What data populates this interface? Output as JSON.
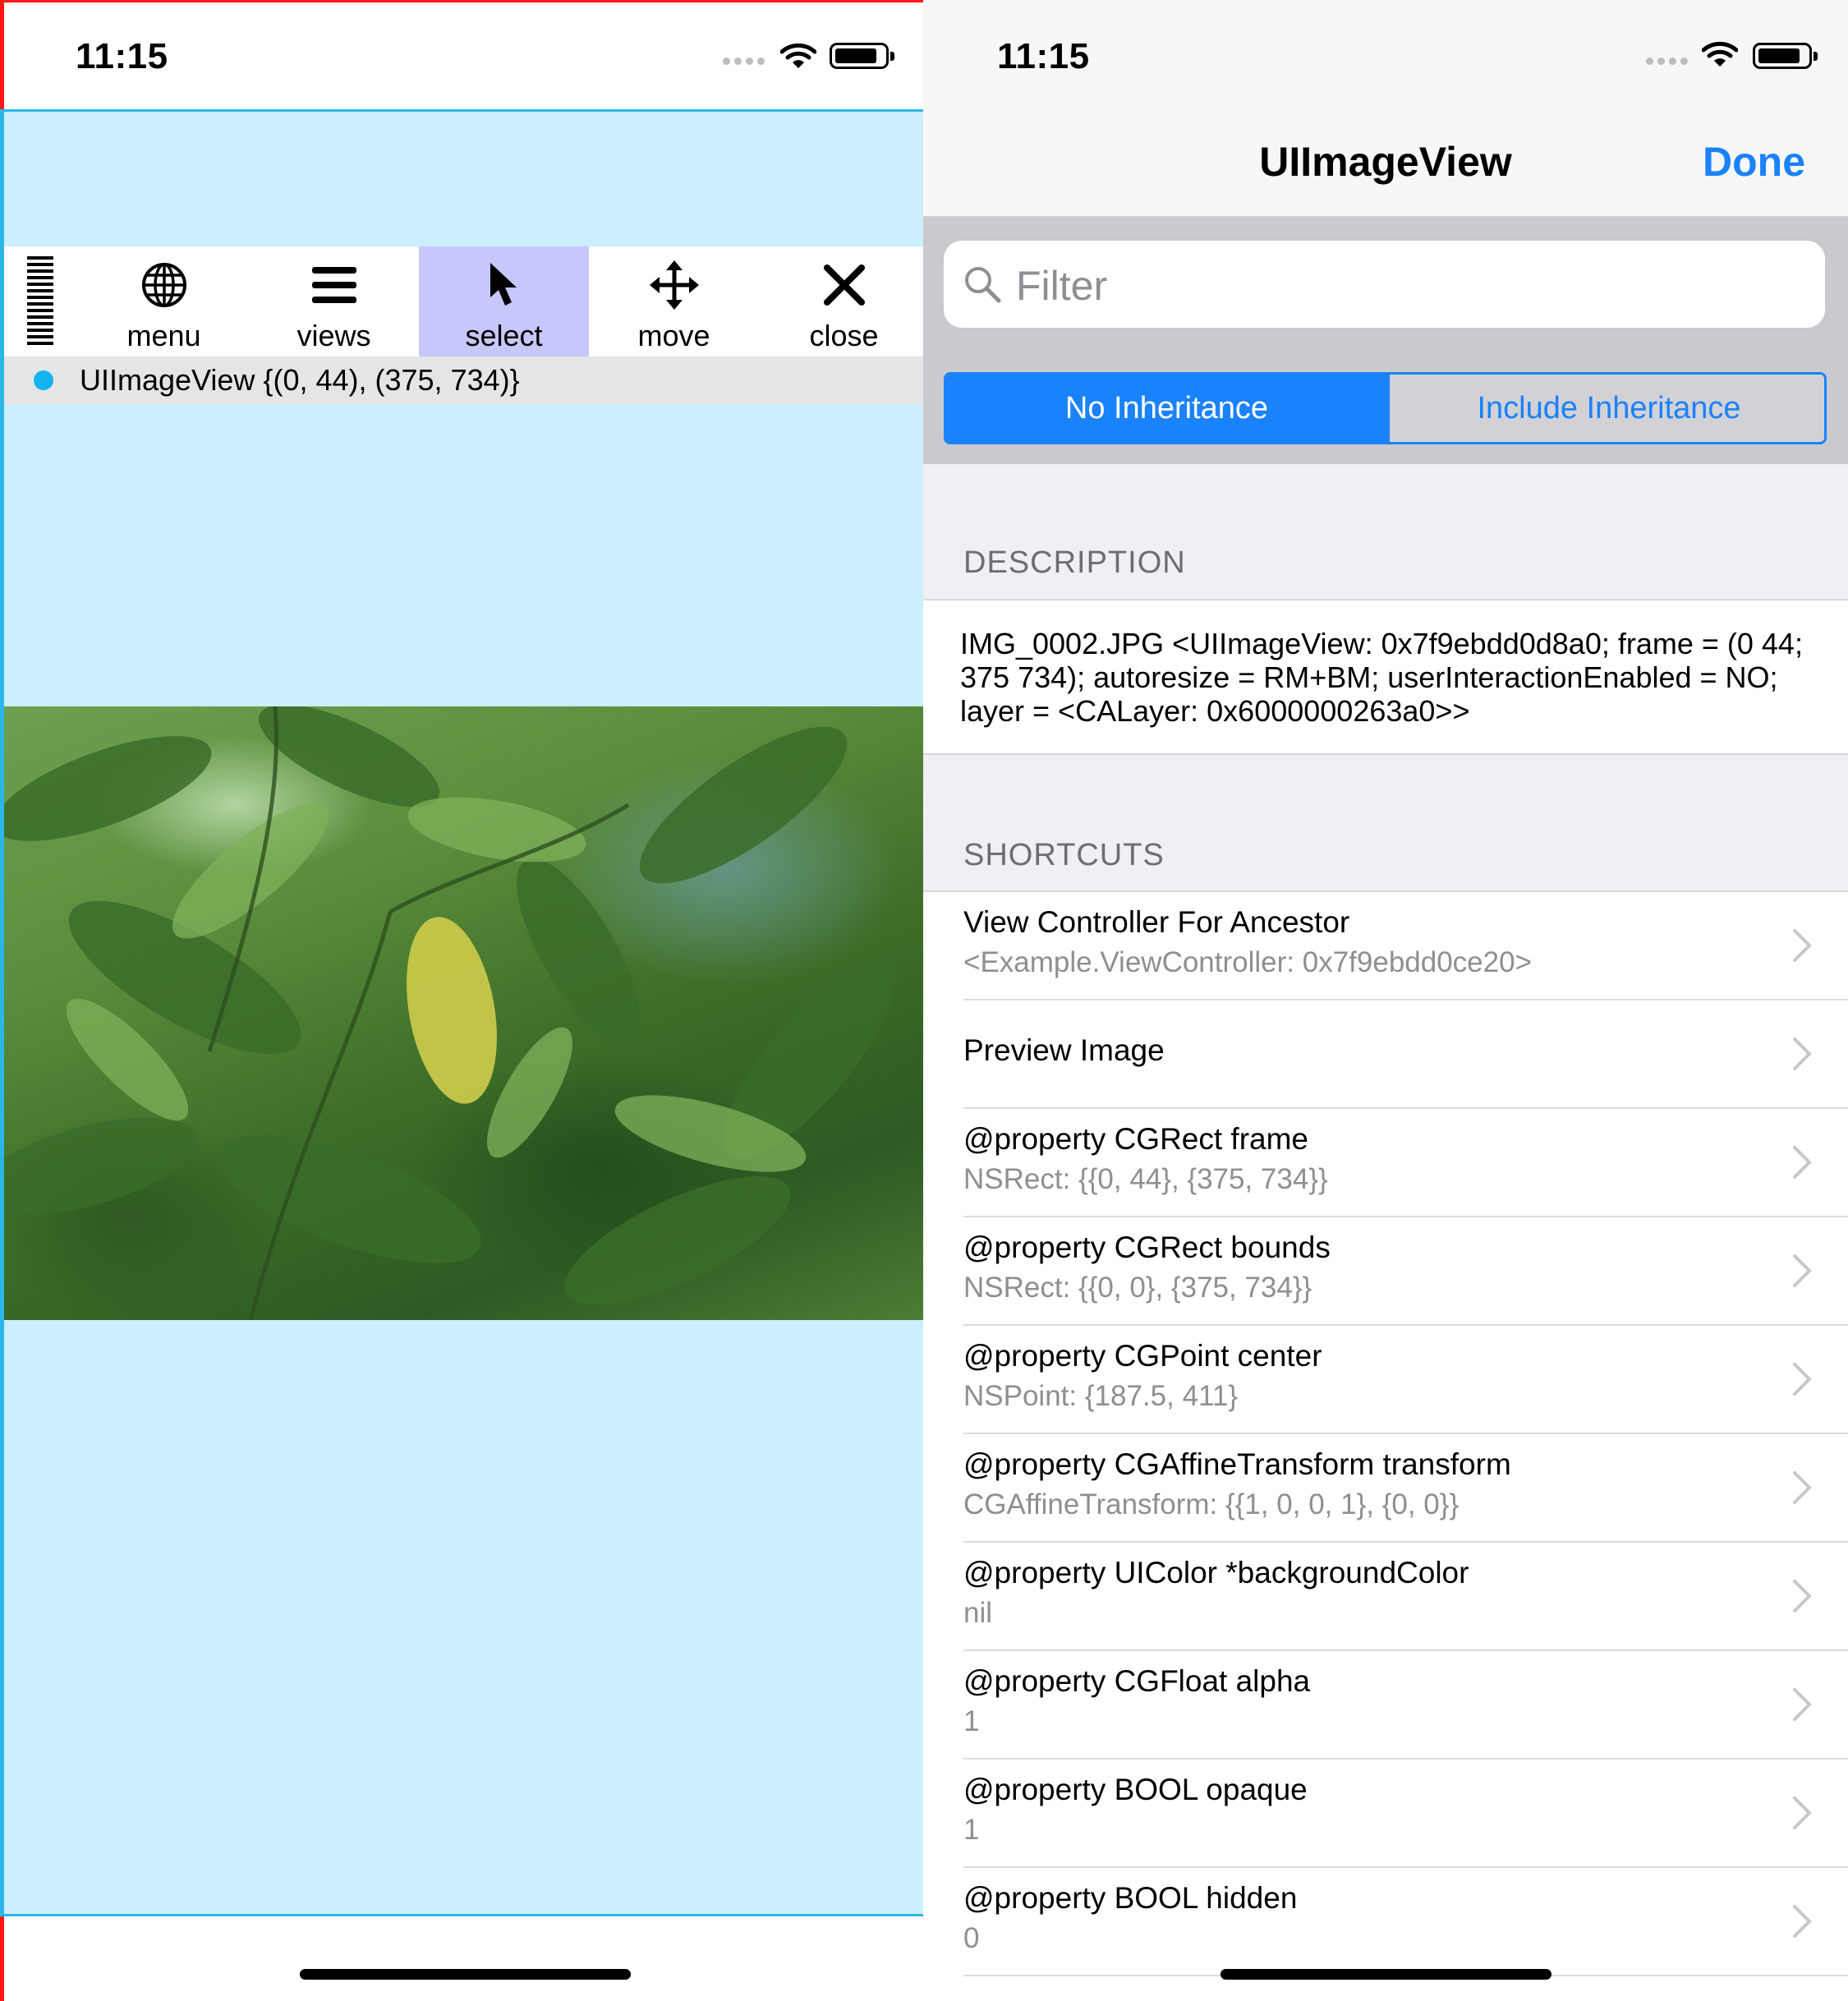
{
  "left_phone": {
    "status_time": "11:15",
    "toolbar": {
      "buttons": [
        {
          "label": "menu",
          "icon": "globe-icon",
          "active": false
        },
        {
          "label": "views",
          "icon": "hamburger-icon",
          "active": false
        },
        {
          "label": "select",
          "icon": "cursor-arrow-icon",
          "active": true
        },
        {
          "label": "move",
          "icon": "move-arrows-icon",
          "active": false
        },
        {
          "label": "close",
          "icon": "close-x-icon",
          "active": false
        }
      ]
    },
    "selection": {
      "text": "UIImageView {(0, 44), (375, 734)}"
    },
    "colors": {
      "background": "#cbeffc",
      "accent_blue": "#2ab7e8",
      "select_highlight": "#c7c7fb"
    }
  },
  "right_phone": {
    "status_time": "11:15",
    "nav": {
      "title": "UIImageView",
      "done_label": "Done"
    },
    "filter": {
      "placeholder": "Filter"
    },
    "segment": {
      "selected": "No Inheritance",
      "other": "Include Inheritance"
    },
    "description": {
      "header": "DESCRIPTION",
      "text": "IMG_0002.JPG <UIImageView: 0x7f9ebdd0d8a0; frame = (0 44; 375 734); autoresize = RM+BM; userInteractionEnabled = NO; layer = <CALayer: 0x6000000263a0>>"
    },
    "shortcuts": {
      "header": "SHORTCUTS",
      "rows": [
        {
          "title": "View Controller For Ancestor",
          "subtitle": "<Example.ViewController: 0x7f9ebdd0ce20>"
        },
        {
          "title": "Preview Image",
          "subtitle": ""
        },
        {
          "title": "@property CGRect frame",
          "subtitle": "NSRect: {{0, 44}, {375, 734}}"
        },
        {
          "title": "@property CGRect bounds",
          "subtitle": "NSRect: {{0, 0}, {375, 734}}"
        },
        {
          "title": "@property CGPoint center",
          "subtitle": "NSPoint: {187.5, 411}"
        },
        {
          "title": "@property CGAffineTransform transform",
          "subtitle": "CGAffineTransform: {{1, 0, 0, 1}, {0, 0}}"
        },
        {
          "title": "@property UIColor *backgroundColor",
          "subtitle": "nil"
        },
        {
          "title": "@property CGFloat alpha",
          "subtitle": "1"
        },
        {
          "title": "@property BOOL opaque",
          "subtitle": "1"
        },
        {
          "title": "@property BOOL hidden",
          "subtitle": "0"
        }
      ]
    },
    "colors": {
      "tint": "#1a82fb",
      "annotation_circle": "#ff9500"
    }
  }
}
